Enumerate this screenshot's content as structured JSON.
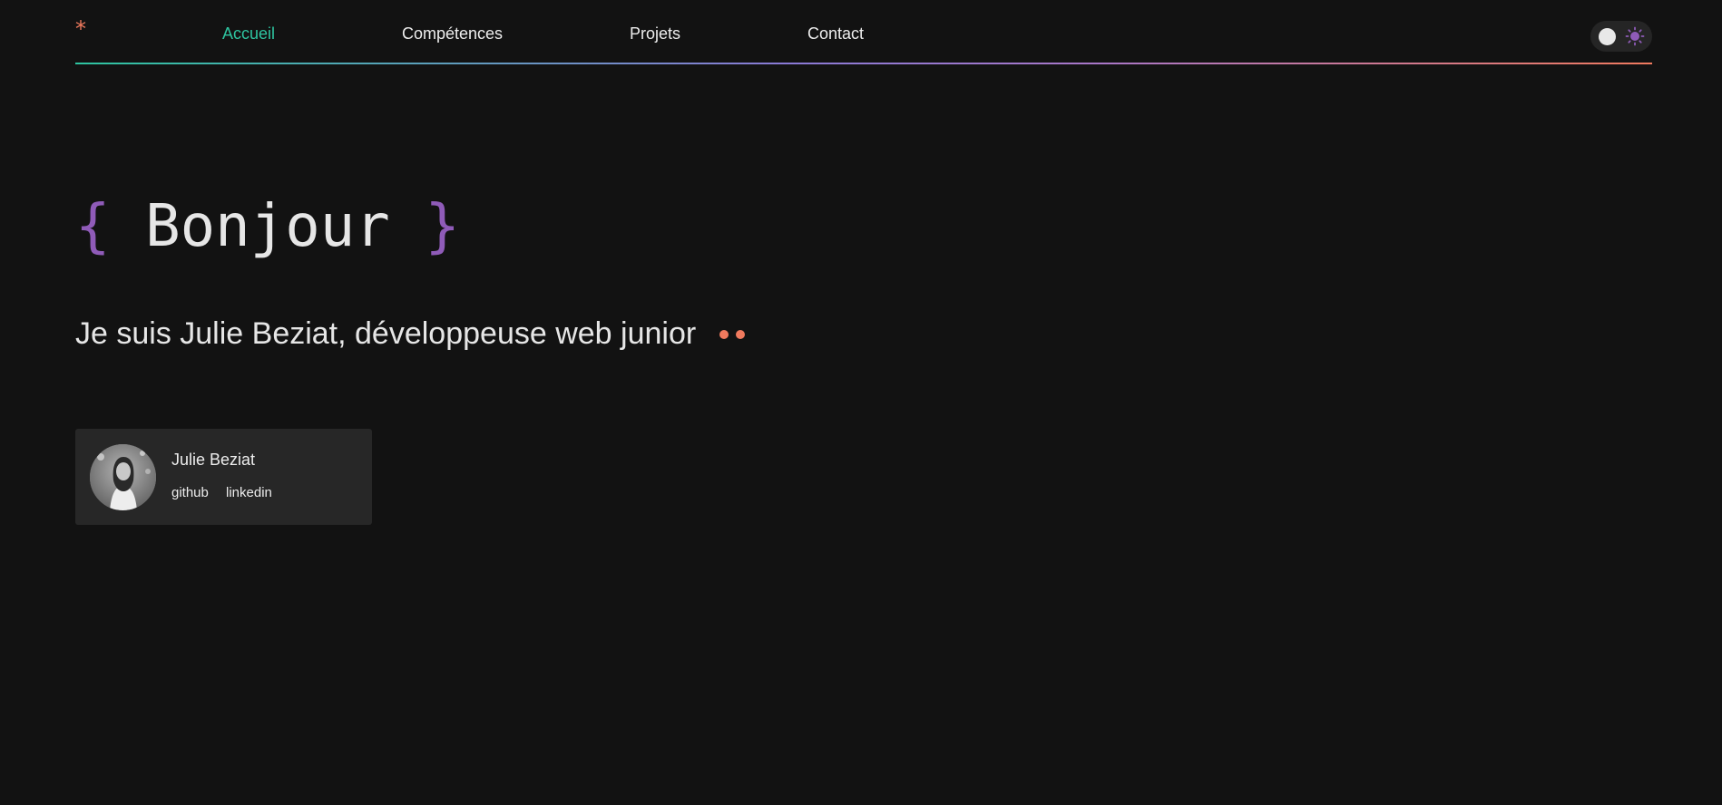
{
  "nav": {
    "logo_symbol": "*",
    "links": [
      {
        "label": "Accueil",
        "active": true
      },
      {
        "label": "Compétences",
        "active": false
      },
      {
        "label": "Projets",
        "active": false
      },
      {
        "label": "Contact",
        "active": false
      }
    ]
  },
  "theme_toggle": {
    "icon": "sun-icon",
    "accent": "#8f5bb8"
  },
  "hero": {
    "open_brace": "{",
    "greeting": "Bonjour",
    "close_brace": "}",
    "subtitle": "Je suis Julie Beziat, développeuse web junior"
  },
  "profile": {
    "name": "Julie Beziat",
    "links": [
      "github",
      "linkedin"
    ]
  },
  "colors": {
    "background": "#121212",
    "accent_teal": "#2ec4a0",
    "accent_purple": "#8f5bb8",
    "accent_coral": "#f07a5e",
    "card_background": "#272727"
  }
}
